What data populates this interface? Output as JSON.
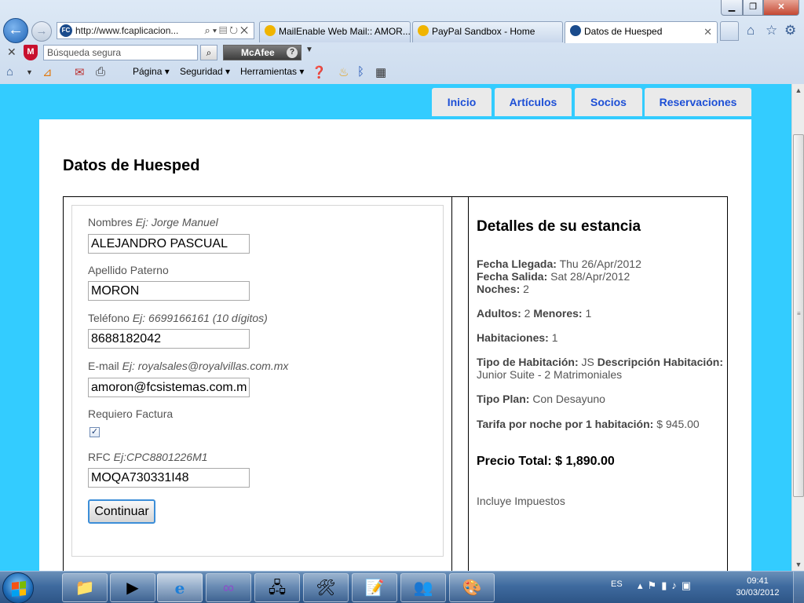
{
  "browser": {
    "address_url": "http://www.fcaplicacion...",
    "tabs": [
      {
        "label": "MailEnable Web Mail:: AMOR...",
        "active": false
      },
      {
        "label": "PayPal Sandbox - Home",
        "active": false
      },
      {
        "label": "Datos de Huesped",
        "active": true
      }
    ],
    "search_placeholder": "Búsqueda segura",
    "mcafee_label": "McAfee",
    "command_bar": {
      "page_menu": "Página",
      "security_menu": "Seguridad",
      "tools_menu": "Herramientas"
    }
  },
  "site": {
    "menu": [
      "Inicio",
      "Artículos",
      "Socios",
      "Reservaciones"
    ],
    "page_title": "Datos de Huesped"
  },
  "form": {
    "nombres": {
      "label": "Nombres",
      "hint": "Ej: Jorge Manuel",
      "value": "ALEJANDRO PASCUAL"
    },
    "apellido": {
      "label": "Apellido Paterno",
      "value": "MORON"
    },
    "telefono": {
      "label": "Teléfono",
      "hint": "Ej: 6699166161 (10 dígitos)",
      "value": "8688182042"
    },
    "email": {
      "label": "E-mail",
      "hint": "Ej: royalsales@royalvillas.com.mx",
      "value": "amoron@fcsistemas.com.m"
    },
    "factura": {
      "label": "Requiero Factura",
      "checked": true
    },
    "rfc": {
      "label": "RFC",
      "hint": "Ej:CPC8801226M1",
      "value": "MOQA730331I48"
    },
    "submit_label": "Continuar"
  },
  "details": {
    "title": "Detalles de su estancia",
    "fecha_llegada_label": "Fecha Llegada:",
    "fecha_llegada": "Thu 26/Apr/2012",
    "fecha_salida_label": "Fecha Salida:",
    "fecha_salida": "Sat 28/Apr/2012",
    "noches_label": "Noches:",
    "noches": "2",
    "adultos_label": "Adultos:",
    "adultos": "2",
    "menores_label": "Menores:",
    "menores": "1",
    "habitaciones_label": "Habitaciones:",
    "habitaciones": "1",
    "tipo_hab_label": "Tipo de Habitación:",
    "tipo_hab": "JS",
    "desc_hab_label": "Descripción Habitación:",
    "desc_hab": "Junior Suite - 2 Matrimoniales",
    "tipo_plan_label": "Tipo Plan:",
    "tipo_plan": "Con Desayuno",
    "tarifa_label": "Tarifa por noche por 1 habitación:",
    "tarifa": "$ 945.00",
    "total_label": "Precio Total:",
    "total": "$ 1,890.00",
    "note": "Incluye Impuestos"
  },
  "taskbar": {
    "language": "ES",
    "time": "09:41",
    "date": "30/03/2012"
  },
  "colors": {
    "page_background": "#33ccff",
    "menu_text": "#1d4fd6",
    "menu_background": "#eaeaea"
  }
}
